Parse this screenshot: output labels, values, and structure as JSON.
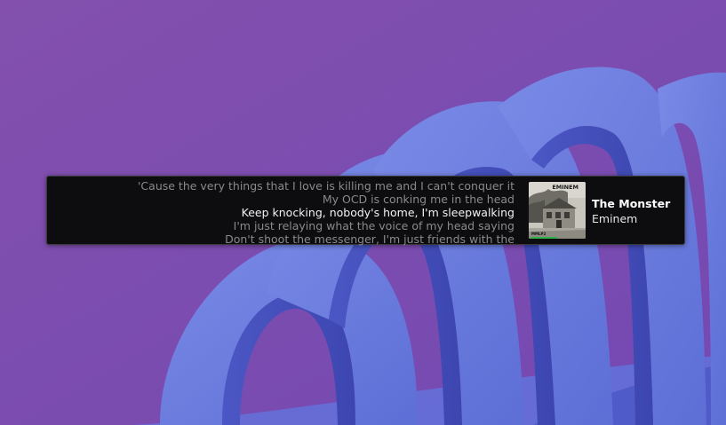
{
  "lyrics_widget": {
    "lines": [
      {
        "text": "'Cause the very things that I love is killing me and I can't conquer it",
        "current": false
      },
      {
        "text": "My OCD is conking me in the head",
        "current": false
      },
      {
        "text": "Keep knocking, nobody's home, I'm sleepwalking",
        "current": true
      },
      {
        "text": "I'm just relaying what the voice of my head saying",
        "current": false
      },
      {
        "text": "Don't shoot the messenger, I'm just friends with the",
        "current": false
      }
    ],
    "track": {
      "title": "The Monster",
      "artist": "Eminem",
      "cover_label": "EMINEM",
      "cover_bottom_label": "MMLP2"
    }
  },
  "colors": {
    "wallpaper_bg": "#7f4fae",
    "ribbon_blue": "#6b7fdf",
    "widget_bg": "#0d0d0f",
    "current_line": "#f2f2f2",
    "other_line": "#8a8a8d",
    "cover_progress": "#2fb24c"
  }
}
